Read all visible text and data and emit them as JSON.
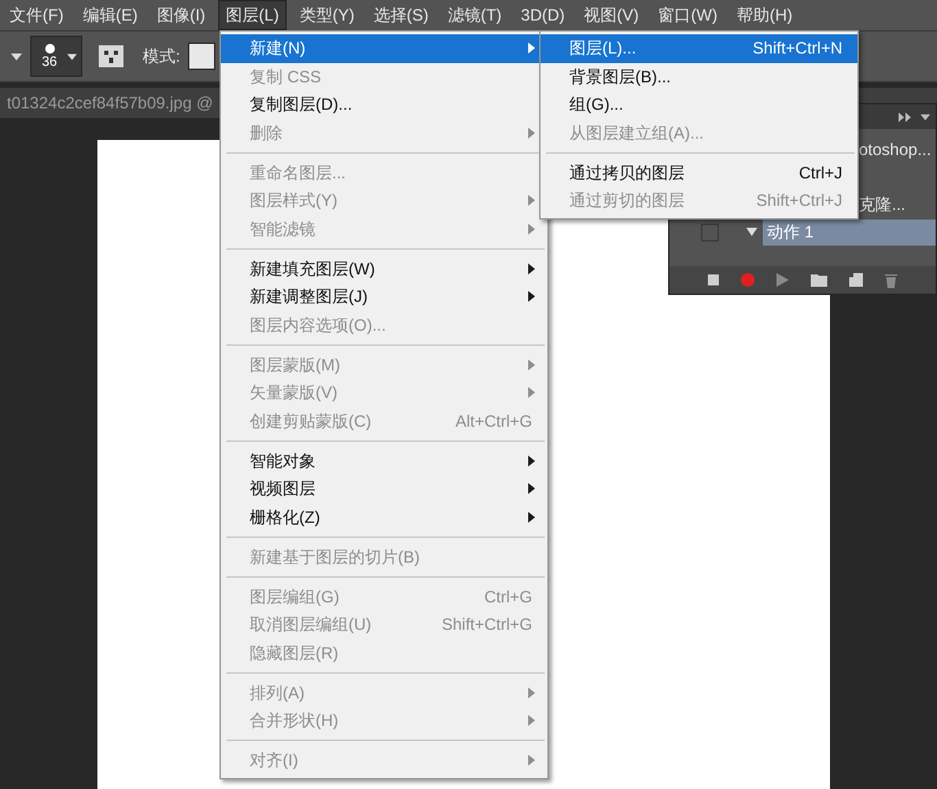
{
  "menubar": [
    {
      "label": "文件(F)",
      "selected": false
    },
    {
      "label": "编辑(E)",
      "selected": false
    },
    {
      "label": "图像(I)",
      "selected": false
    },
    {
      "label": "图层(L)",
      "selected": true
    },
    {
      "label": "类型(Y)",
      "selected": false
    },
    {
      "label": "选择(S)",
      "selected": false
    },
    {
      "label": "滤镜(T)",
      "selected": false
    },
    {
      "label": "3D(D)",
      "selected": false
    },
    {
      "label": "视图(V)",
      "selected": false
    },
    {
      "label": "窗口(W)",
      "selected": false
    },
    {
      "label": "帮助(H)",
      "selected": false
    }
  ],
  "toolbar": {
    "brush_size": "36",
    "mode_label": "模式:"
  },
  "document_tab": {
    "title": "t01324c2cef84f57b09.jpg @"
  },
  "layer_menu": [
    {
      "kind": "item",
      "label": "新建(N)",
      "submenu": true,
      "disabled": false,
      "selected": true
    },
    {
      "kind": "item",
      "label": "复制 CSS",
      "disabled": true,
      "selected": false
    },
    {
      "kind": "item",
      "label": "复制图层(D)...",
      "disabled": false,
      "selected": false
    },
    {
      "kind": "item",
      "label": "删除",
      "submenu": true,
      "disabled": true,
      "selected": false
    },
    {
      "kind": "separator"
    },
    {
      "kind": "item",
      "label": "重命名图层...",
      "disabled": true,
      "selected": false
    },
    {
      "kind": "item",
      "label": "图层样式(Y)",
      "submenu": true,
      "disabled": true,
      "selected": false
    },
    {
      "kind": "item",
      "label": "智能滤镜",
      "submenu": true,
      "disabled": true,
      "selected": false
    },
    {
      "kind": "separator"
    },
    {
      "kind": "item",
      "label": "新建填充图层(W)",
      "submenu": true,
      "disabled": false,
      "selected": false
    },
    {
      "kind": "item",
      "label": "新建调整图层(J)",
      "submenu": true,
      "disabled": false,
      "selected": false
    },
    {
      "kind": "item",
      "label": "图层内容选项(O)...",
      "disabled": true,
      "selected": false
    },
    {
      "kind": "separator"
    },
    {
      "kind": "item",
      "label": "图层蒙版(M)",
      "submenu": true,
      "disabled": true,
      "selected": false
    },
    {
      "kind": "item",
      "label": "矢量蒙版(V)",
      "submenu": true,
      "disabled": true,
      "selected": false
    },
    {
      "kind": "item",
      "label": "创建剪贴蒙版(C)",
      "shortcut": "Alt+Ctrl+G",
      "disabled": true,
      "selected": false
    },
    {
      "kind": "separator"
    },
    {
      "kind": "item",
      "label": "智能对象",
      "submenu": true,
      "disabled": false,
      "selected": false
    },
    {
      "kind": "item",
      "label": "视频图层",
      "submenu": true,
      "disabled": false,
      "selected": false
    },
    {
      "kind": "item",
      "label": "栅格化(Z)",
      "submenu": true,
      "disabled": false,
      "selected": false
    },
    {
      "kind": "separator"
    },
    {
      "kind": "item",
      "label": "新建基于图层的切片(B)",
      "disabled": true,
      "selected": false
    },
    {
      "kind": "separator"
    },
    {
      "kind": "item",
      "label": "图层编组(G)",
      "shortcut": "Ctrl+G",
      "disabled": true,
      "selected": false
    },
    {
      "kind": "item",
      "label": "取消图层编组(U)",
      "shortcut": "Shift+Ctrl+G",
      "disabled": true,
      "selected": false
    },
    {
      "kind": "item",
      "label": "隐藏图层(R)",
      "disabled": true,
      "selected": false
    },
    {
      "kind": "separator"
    },
    {
      "kind": "item",
      "label": "排列(A)",
      "submenu": true,
      "disabled": true,
      "selected": false
    },
    {
      "kind": "item",
      "label": "合并形状(H)",
      "submenu": true,
      "disabled": true,
      "selected": false
    },
    {
      "kind": "separator"
    },
    {
      "kind": "item",
      "label": "对齐(I)",
      "submenu": true,
      "disabled": true,
      "selected": false
    }
  ],
  "new_submenu": [
    {
      "kind": "item",
      "label": "图层(L)...",
      "shortcut": "Shift+Ctrl+N",
      "disabled": false,
      "selected": true
    },
    {
      "kind": "item",
      "label": "背景图层(B)...",
      "disabled": false,
      "selected": false
    },
    {
      "kind": "item",
      "label": "组(G)...",
      "disabled": false,
      "selected": false
    },
    {
      "kind": "item",
      "label": "从图层建立组(A)...",
      "disabled": true,
      "selected": false
    },
    {
      "kind": "separator"
    },
    {
      "kind": "item",
      "label": "通过拷贝的图层",
      "shortcut": "Ctrl+J",
      "disabled": false,
      "selected": false
    },
    {
      "kind": "item",
      "label": "通过剪切的图层",
      "shortcut": "Shift+Ctrl+J",
      "disabled": true,
      "selected": false
    }
  ],
  "actions_panel": {
    "rows": [
      {
        "label": "otoshop...",
        "selected": false
      },
      {
        "label": "克隆...",
        "selected": false
      },
      {
        "label": "动作 1",
        "selected": true,
        "checked": false
      }
    ]
  }
}
